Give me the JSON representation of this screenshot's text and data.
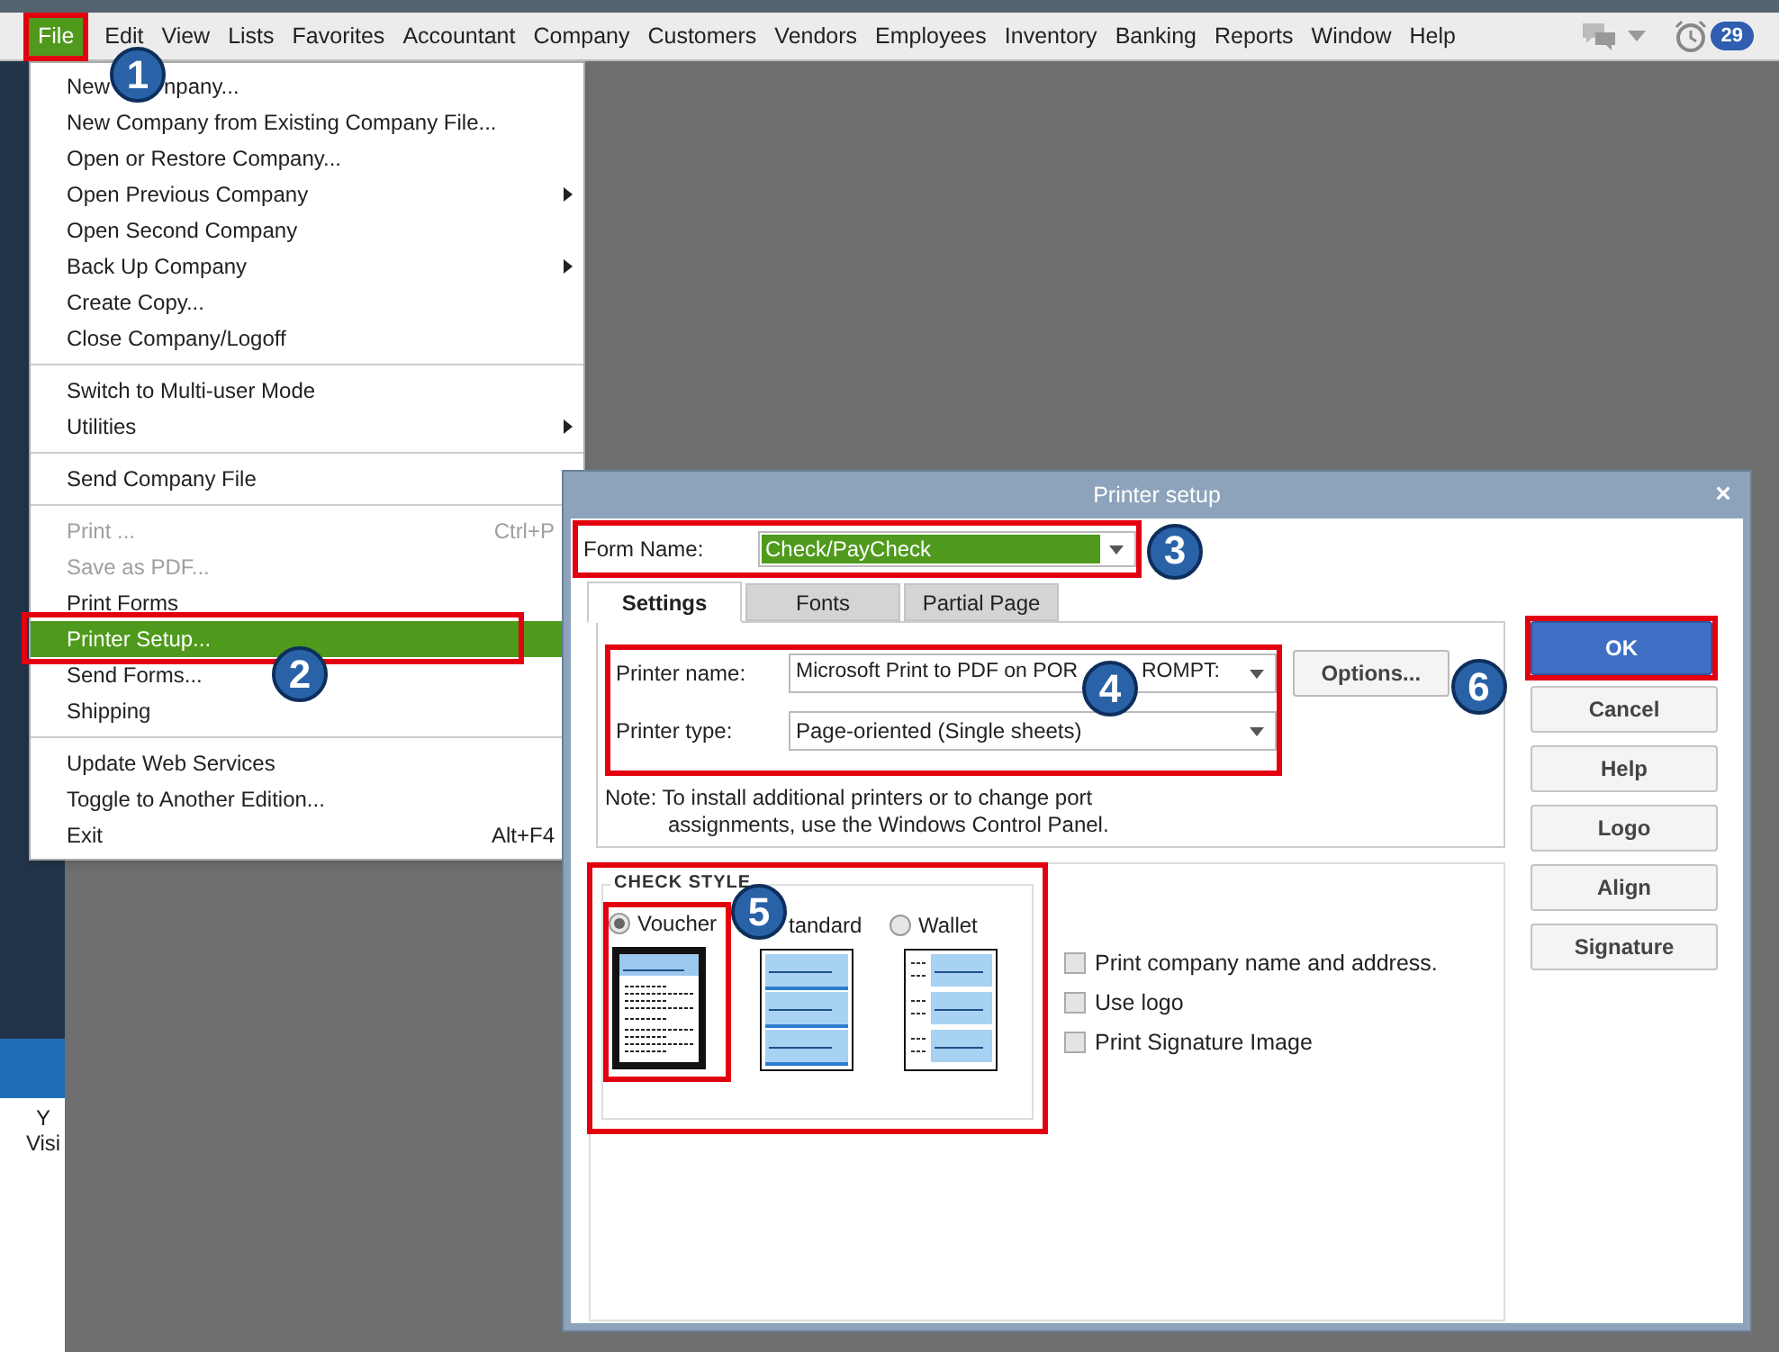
{
  "menubar": {
    "items": [
      {
        "label": "File",
        "selected": true
      },
      {
        "label": "Edit",
        "selected": false
      },
      {
        "label": "View",
        "selected": false
      },
      {
        "label": "Lists",
        "selected": false
      },
      {
        "label": "Favorites",
        "selected": false
      },
      {
        "label": "Accountant",
        "selected": false
      },
      {
        "label": "Company",
        "selected": false
      },
      {
        "label": "Customers",
        "selected": false
      },
      {
        "label": "Vendors",
        "selected": false
      },
      {
        "label": "Employees",
        "selected": false
      },
      {
        "label": "Inventory",
        "selected": false
      },
      {
        "label": "Banking",
        "selected": false
      },
      {
        "label": "Reports",
        "selected": false
      },
      {
        "label": "Window",
        "selected": false
      },
      {
        "label": "Help",
        "selected": false
      }
    ],
    "reminders_count": "29"
  },
  "sidebar": {
    "texts": [
      "Y",
      "Visi"
    ]
  },
  "file_menu": {
    "sections": [
      [
        {
          "label": "New",
          "badge": "1",
          "label_after_badge": "npany...",
          "disabled": false,
          "selected": false
        },
        {
          "label": "New Company from Existing Company File...",
          "disabled": false,
          "selected": false
        },
        {
          "label": "Open or Restore Company...",
          "disabled": false,
          "selected": false
        },
        {
          "label": "Open Previous Company",
          "disabled": false,
          "selected": false,
          "submenu": true
        },
        {
          "label": "Open Second Company",
          "disabled": false,
          "selected": false
        },
        {
          "label": "Back Up Company",
          "disabled": false,
          "selected": false,
          "submenu": true
        },
        {
          "label": "Create Copy...",
          "disabled": false,
          "selected": false
        },
        {
          "label": "Close Company/Logoff",
          "disabled": false,
          "selected": false
        }
      ],
      [
        {
          "label": "Switch to Multi-user Mode",
          "disabled": false,
          "selected": false
        },
        {
          "label": "Utilities",
          "disabled": false,
          "selected": false,
          "submenu": true
        }
      ],
      [
        {
          "label": "Send Company File",
          "disabled": false,
          "selected": false
        }
      ],
      [
        {
          "label": "Print ...",
          "shortcut": "Ctrl+P",
          "disabled": true,
          "selected": false
        },
        {
          "label": "Save as PDF...",
          "disabled": true,
          "selected": false
        },
        {
          "label": "Print Forms",
          "disabled": false,
          "selected": false
        },
        {
          "label": "Printer Setup...",
          "badge": "2",
          "disabled": false,
          "selected": true
        },
        {
          "label": "Send Forms...",
          "disabled": false,
          "selected": false
        },
        {
          "label": "Shipping",
          "disabled": false,
          "selected": false
        }
      ],
      [
        {
          "label": "Update Web Services",
          "disabled": false,
          "selected": false
        },
        {
          "label": "Toggle to Another Edition...",
          "disabled": false,
          "selected": false
        },
        {
          "label": "Exit",
          "shortcut": "Alt+F4",
          "disabled": false,
          "selected": false
        }
      ]
    ]
  },
  "dialog": {
    "title": "Printer setup",
    "close": "×",
    "form_name": {
      "label": "Form Name:",
      "value": "Check/PayCheck",
      "badge": "3"
    },
    "tabs": [
      {
        "label": "Settings",
        "selected": true
      },
      {
        "label": "Fonts",
        "selected": false
      },
      {
        "label": "Partial Page",
        "selected": false
      }
    ],
    "printer_name": {
      "label": "Printer name:",
      "value": "Microsoft Print to PDF on POR",
      "badge": "4",
      "value_after_badge": "ROMPT:"
    },
    "printer_type": {
      "label": "Printer type:",
      "value": "Page-oriented (Single sheets)"
    },
    "options_button": {
      "label": "Options...",
      "badge": "6"
    },
    "note": [
      "Note: To install additional printers or to change port",
      "assignments, use the Windows Control Panel."
    ],
    "check_style": {
      "title": "CHECK STYLE",
      "options": [
        {
          "label": "Voucher",
          "kind": "voucher",
          "selected": true
        },
        {
          "label": "tandard",
          "badge": "5",
          "kind": "standard",
          "selected": false
        },
        {
          "label": "Wallet",
          "kind": "wallet",
          "selected": false
        }
      ],
      "checkboxes": [
        {
          "label": "Print company name and address.",
          "checked": false
        },
        {
          "label": "Use logo",
          "checked": false
        },
        {
          "label": "Print Signature Image",
          "checked": false
        }
      ]
    },
    "buttons": [
      {
        "label": "OK",
        "primary": true
      },
      {
        "label": "Cancel",
        "primary": false
      },
      {
        "label": "Help",
        "primary": false
      },
      {
        "label": "Logo",
        "primary": false
      },
      {
        "label": "Align",
        "primary": false
      },
      {
        "label": "Signature",
        "primary": false
      }
    ]
  }
}
